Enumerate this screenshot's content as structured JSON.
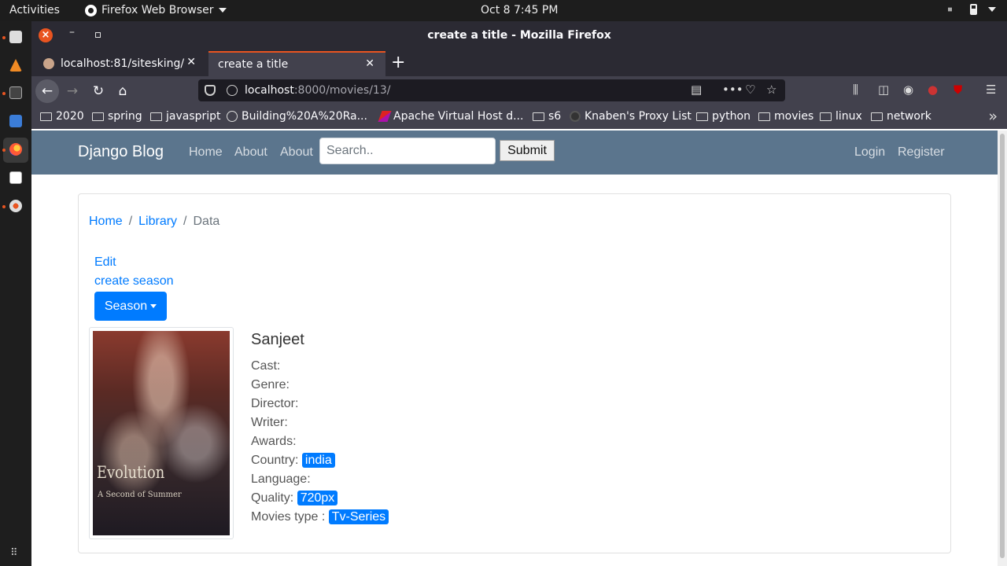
{
  "system": {
    "activities": "Activities",
    "app_menu": "Firefox Web Browser",
    "clock": "Oct 8   7:45 PM"
  },
  "window": {
    "title": "create a title - Mozilla Firefox"
  },
  "tabs": [
    {
      "label": "localhost:81/sitesking/"
    },
    {
      "label": "create a title"
    }
  ],
  "url": {
    "host": "localhost",
    "rest": ":8000/movies/13/"
  },
  "bookmarks": [
    {
      "label": "2020",
      "icon": "folder-icon"
    },
    {
      "label": "spring",
      "icon": "folder-icon"
    },
    {
      "label": "javaspript",
      "icon": "folder-icon"
    },
    {
      "label": "Building%20A%20Ra...",
      "icon": "globe-icon"
    },
    {
      "label": "Apache Virtual Host d...",
      "icon": "apache-feather-icon"
    },
    {
      "label": "s6",
      "icon": "folder-icon"
    },
    {
      "label": "Knaben's Proxy List",
      "icon": "proxy-icon"
    },
    {
      "label": "python",
      "icon": "folder-icon"
    },
    {
      "label": "movies",
      "icon": "folder-icon"
    },
    {
      "label": "linux",
      "icon": "folder-icon"
    },
    {
      "label": "network",
      "icon": "folder-icon"
    }
  ],
  "site": {
    "brand": "Django Blog",
    "nav": [
      "Home",
      "About",
      "About"
    ],
    "search_placeholder": "Search..",
    "submit": "Submit",
    "login": "Login",
    "register": "Register"
  },
  "breadcrumb": [
    "Home",
    "Library",
    "Data"
  ],
  "actions": {
    "edit": "Edit",
    "create_season": "create season",
    "season_button": "Season"
  },
  "poster": {
    "title": "Evolution",
    "subtitle": "A Second of Summer"
  },
  "movie": {
    "title": "Sanjeet",
    "fields": [
      {
        "label": "Cast:",
        "value": ""
      },
      {
        "label": "Genre:",
        "value": ""
      },
      {
        "label": "Director:",
        "value": ""
      },
      {
        "label": "Writer:",
        "value": ""
      },
      {
        "label": "Awards:",
        "value": ""
      },
      {
        "label": "Country:",
        "value": "india"
      },
      {
        "label": "Language:",
        "value": ""
      },
      {
        "label": "Quality:",
        "value": "720px"
      },
      {
        "label": "Movies type :",
        "value": "Tv-Series"
      }
    ]
  },
  "colors": {
    "site_nav": "#5b758d",
    "link": "#007bff",
    "badge": "#007bff",
    "tab_accent": "#e95420"
  }
}
